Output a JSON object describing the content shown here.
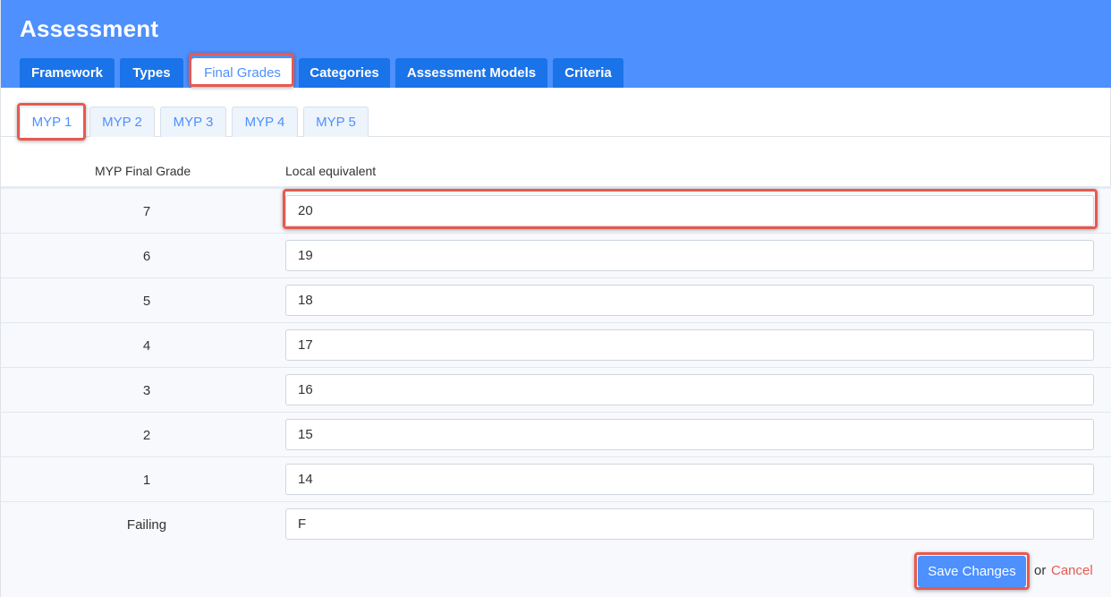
{
  "header": {
    "title": "Assessment"
  },
  "main_tabs": [
    {
      "label": "Framework"
    },
    {
      "label": "Types"
    },
    {
      "label": "Final Grades"
    },
    {
      "label": "Categories"
    },
    {
      "label": "Assessment Models"
    },
    {
      "label": "Criteria"
    }
  ],
  "active_main_tab": "Final Grades",
  "sub_tabs": [
    {
      "label": "MYP 1"
    },
    {
      "label": "MYP 2"
    },
    {
      "label": "MYP 3"
    },
    {
      "label": "MYP 4"
    },
    {
      "label": "MYP 5"
    }
  ],
  "active_sub_tab": "MYP 1",
  "table": {
    "headers": {
      "grade": "MYP Final Grade",
      "equivalent": "Local equivalent"
    },
    "rows": [
      {
        "grade": "7",
        "value": "20"
      },
      {
        "grade": "6",
        "value": "19"
      },
      {
        "grade": "5",
        "value": "18"
      },
      {
        "grade": "4",
        "value": "17"
      },
      {
        "grade": "3",
        "value": "16"
      },
      {
        "grade": "2",
        "value": "15"
      },
      {
        "grade": "1",
        "value": "14"
      },
      {
        "grade": "Failing",
        "value": "F"
      }
    ]
  },
  "footer": {
    "save_label": "Save Changes",
    "or_text": "or",
    "cancel_label": "Cancel"
  },
  "colors": {
    "header_bg": "#4d90fe",
    "tab_bg": "#1a73e8",
    "accent": "#4d90fe",
    "highlight": "#e8594f",
    "cancel": "#e8594f"
  }
}
